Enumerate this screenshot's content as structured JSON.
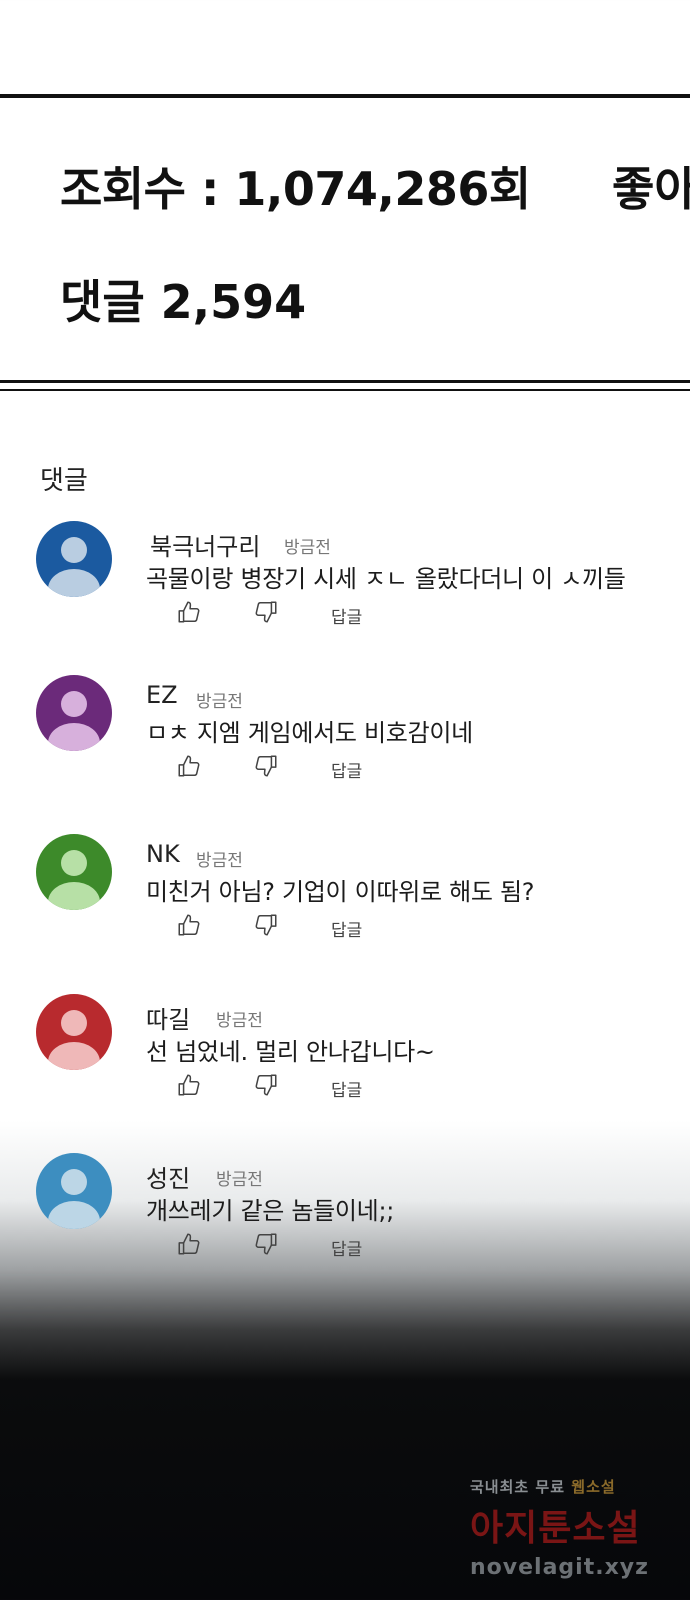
{
  "stats": {
    "views": "조회수 : 1,074,286회",
    "likes": "좋아",
    "comments": "댓글 2,594"
  },
  "section_title": "댓글",
  "actions": {
    "reply_label": "답글",
    "like_icon": "thumbs-up-icon",
    "dislike_icon": "thumbs-down-icon"
  },
  "comments": [
    {
      "name": "북극너구리",
      "time": "방금전",
      "text": "곡물이랑 병장기 시세 ㅈㄴ 올랐다더니 이 ㅅ끼들",
      "avatar_bg": "#1b5aa0",
      "avatar_fg": "#b9cde1"
    },
    {
      "name": "EZ",
      "time": "방금전",
      "text": "ㅁㅊ 지엠 게임에서도 비호감이네",
      "avatar_bg": "#6b2a7a",
      "avatar_fg": "#d7b0dc"
    },
    {
      "name": "NK",
      "time": "방금전",
      "text": "미친거 아님? 기업이 이따위로 해도 됨?",
      "avatar_bg": "#3d8a2a",
      "avatar_fg": "#b7e0a6"
    },
    {
      "name": "따길",
      "time": "방금전",
      "text": "선 넘었네. 멀리 안나갑니다~",
      "avatar_bg": "#b82a2e",
      "avatar_fg": "#efb8b8"
    },
    {
      "name": "성진",
      "time": "방금전",
      "text": "개쓰레기 같은 놈들이네;;",
      "avatar_bg": "#3d8ec0",
      "avatar_fg": "#bcd6e6"
    }
  ],
  "watermark": {
    "top": "국내최초 무료",
    "top_highlight": "웹소설",
    "middle": "아지툰소설",
    "bottom": "novelagit.xyz"
  }
}
